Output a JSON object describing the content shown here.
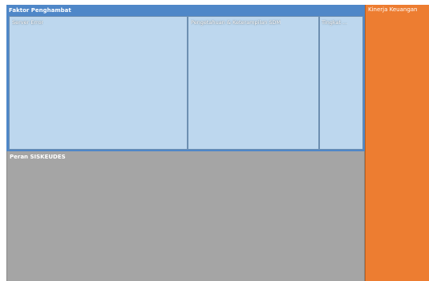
{
  "chart_data": {
    "type": "treemap",
    "title": "",
    "groups": [
      {
        "name": "Faktor Penghambat",
        "color": "#4f87c8",
        "leaves": [
          {
            "name": "Server Error",
            "value": 5
          },
          {
            "name": "Pengetahuan & Keterampilan SDM",
            "value": 4
          },
          {
            "name": "Tingkat ...",
            "value": 1.3
          }
        ]
      },
      {
        "name": "Peran SISKEUDES",
        "color": "#a5a5a5",
        "value": 9
      },
      {
        "name": "Kinerja Keuangan",
        "color": "#ed7d31",
        "value": 4
      }
    ]
  }
}
